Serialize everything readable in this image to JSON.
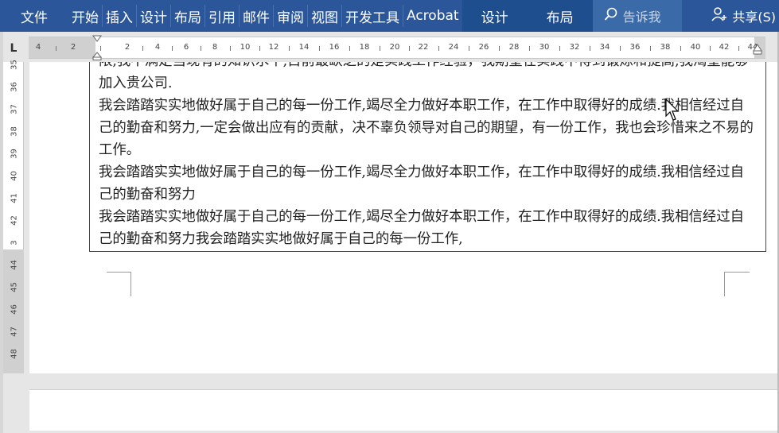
{
  "ribbon": {
    "file_tab": "文件",
    "tabs": [
      "开始",
      "插入",
      "设计",
      "布局",
      "引用",
      "邮件",
      "审阅",
      "视图",
      "开发工具",
      "Acrobat"
    ],
    "context_tabs": [
      "设计",
      "布局"
    ],
    "tell_me": "告诉我",
    "share": "共享(S)",
    "colors": {
      "ribbon": "#2b579a",
      "context": "#1f4e8e"
    }
  },
  "ruler": {
    "corner_glyph": "L",
    "h_numbers": [
      "4",
      "2",
      "2",
      "4",
      "6",
      "8",
      "10",
      "12",
      "14",
      "16",
      "18",
      "20",
      "22",
      "24",
      "26",
      "28",
      "30",
      "32",
      "34",
      "36",
      "38",
      "40",
      "42",
      "44"
    ],
    "v_numbers": [
      "35",
      "36",
      "37",
      "38",
      "39",
      "40",
      "41",
      "42",
      "3",
      "44",
      "45",
      "46",
      "47",
      "48"
    ]
  },
  "document": {
    "paragraphs": [
      "限,我不满足当现有的知识水平,目前最缺乏的是实践工作经验，我期望在实践中得到锻炼和提高,我渴望能够加入贵公司.",
      "我会踏踏实实地做好属于自己的每一份工作,竭尽全力做好本职工作，在工作中取得好的成绩.我相信经过自己的勤奋和努力,一定会做出应有的贡献，决不辜负领导对自己的期望，有一份工作，我也会珍惜来之不易的工作。",
      "我会踏踏实实地做好属于自己的每一份工作,竭尽全力做好本职工作，在工作中取得好的成绩.我相信经过自己的勤奋和努力",
      "我会踏踏实实地做好属于自己的每一份工作,竭尽全力做好本职工作，在工作中取得好的成绩.我相信经过自己的勤奋和努力我会踏踏实实地做好属于自己的每一份工作,"
    ]
  }
}
